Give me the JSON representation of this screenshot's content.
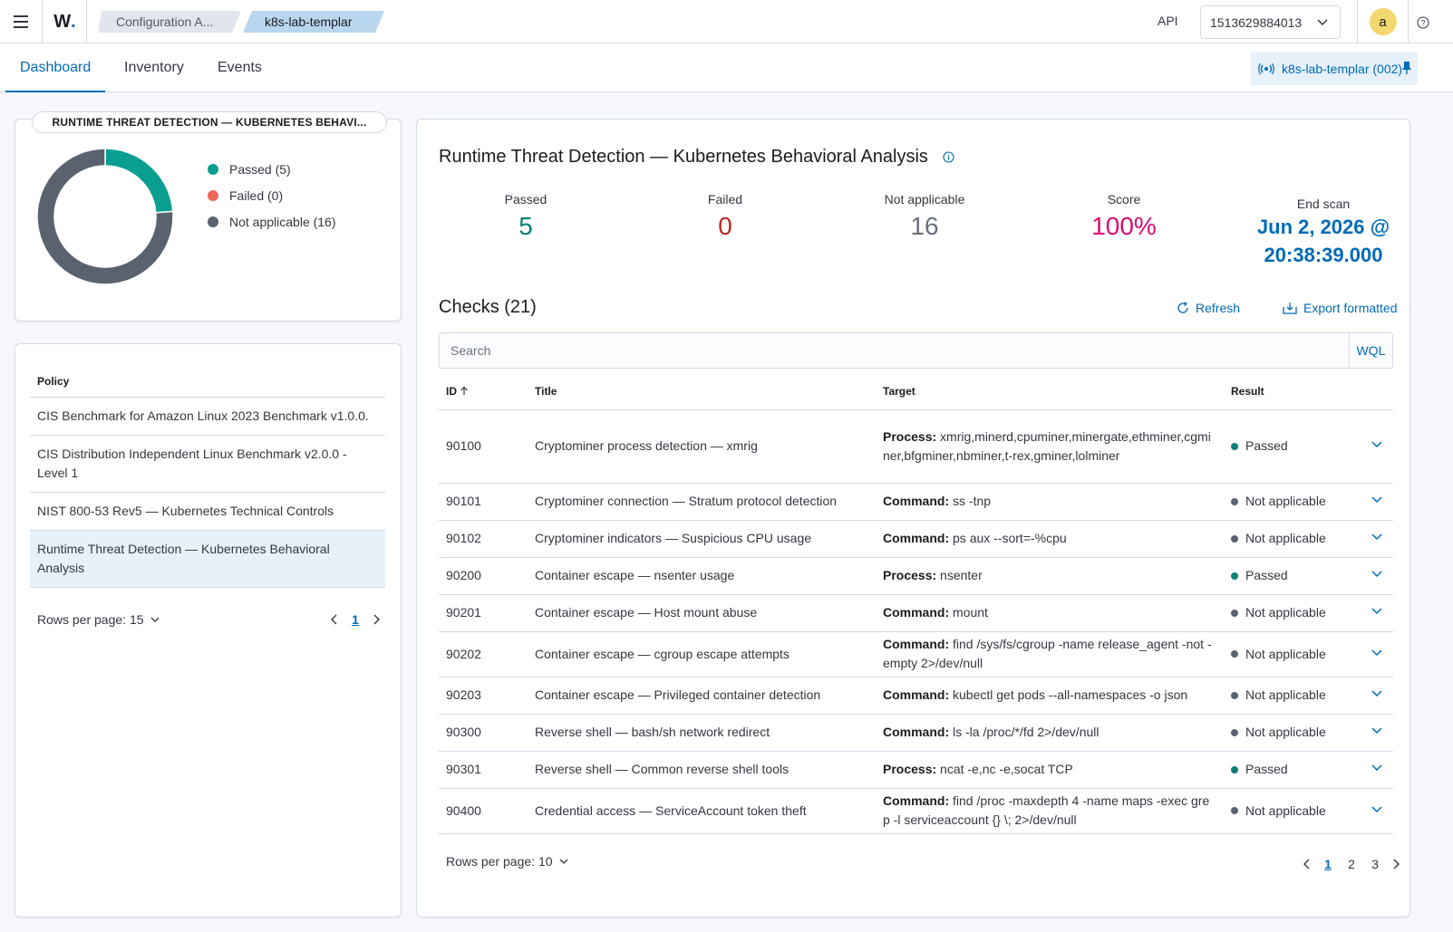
{
  "header": {
    "logo_text": "W",
    "logo_dot": ".",
    "breadcrumbs": [
      "Configuration A...",
      "k8s-lab-templar"
    ],
    "api_label": "API",
    "instance_id": "1513629884013",
    "avatar_letter": "a"
  },
  "tabs": [
    {
      "label": "Dashboard",
      "active": true
    },
    {
      "label": "Inventory",
      "active": false
    },
    {
      "label": "Events",
      "active": false
    }
  ],
  "agent_pill": {
    "label": "k8s-lab-templar (002)"
  },
  "donut": {
    "title": "RUNTIME THREAT DETECTION — KUBERNETES BEHAVI...",
    "legend": [
      "Passed (5)",
      "Failed (0)",
      "Not applicable (16)"
    ],
    "colors": {
      "passed": "#0a9e92",
      "failed": "#f0665e",
      "not_applicable": "#5a6270"
    }
  },
  "chart_data": {
    "type": "pie",
    "categories": [
      "Passed",
      "Failed",
      "Not applicable"
    ],
    "values": [
      5,
      0,
      16
    ]
  },
  "policies": {
    "header": "Policy",
    "items": [
      {
        "label": "CIS Benchmark for Amazon Linux 2023 Benchmark v1.0.0.",
        "selected": false
      },
      {
        "label": "CIS Distribution Independent Linux Benchmark v2.0.0 - Level 1",
        "selected": false
      },
      {
        "label": "NIST 800-53 Rev5 — Kubernetes Technical Controls",
        "selected": false
      },
      {
        "label": "Runtime Threat Detection — Kubernetes Behavioral Analysis",
        "selected": true
      }
    ],
    "rows_per_page": "Rows per page: 15",
    "current_page": "1"
  },
  "summary": {
    "title": "Runtime Threat Detection — Kubernetes Behavioral Analysis",
    "passed_label": "Passed",
    "passed_value": "5",
    "failed_label": "Failed",
    "failed_value": "0",
    "na_label": "Not applicable",
    "na_value": "16",
    "score_label": "Score",
    "score_value": "100%",
    "end_scan_label": "End scan",
    "end_scan_value_line1": "Jun 2, 2026 @",
    "end_scan_value_line2": "20:38:39.000"
  },
  "checks": {
    "title": "Checks (21)",
    "refresh_label": "Refresh",
    "export_label": "Export formatted",
    "search_placeholder": "Search",
    "wql_label": "WQL",
    "columns": {
      "id": "ID",
      "title": "Title",
      "target": "Target",
      "result": "Result"
    },
    "rows": [
      {
        "id": "90100",
        "title": "Cryptominer process detection — xmrig",
        "target_label": "Process:",
        "target_value": "xmrig,minerd,cpuminer,minergate,ethminer,cgminer,bfgminer,nbminer,t-rex,gminer,lolminer",
        "result": "Passed"
      },
      {
        "id": "90101",
        "title": "Cryptominer connection — Stratum protocol detection",
        "target_label": "Command:",
        "target_value": "ss -tnp",
        "result": "Not applicable"
      },
      {
        "id": "90102",
        "title": "Cryptominer indicators — Suspicious CPU usage",
        "target_label": "Command:",
        "target_value": "ps aux --sort=-%cpu",
        "result": "Not applicable"
      },
      {
        "id": "90200",
        "title": "Container escape — nsenter usage",
        "target_label": "Process:",
        "target_value": "nsenter",
        "result": "Passed"
      },
      {
        "id": "90201",
        "title": "Container escape — Host mount abuse",
        "target_label": "Command:",
        "target_value": "mount",
        "result": "Not applicable"
      },
      {
        "id": "90202",
        "title": "Container escape — cgroup escape attempts",
        "target_label": "Command:",
        "target_value": "find /sys/fs/cgroup -name release_agent -not -empty 2>/dev/null",
        "result": "Not applicable"
      },
      {
        "id": "90203",
        "title": "Container escape — Privileged container detection",
        "target_label": "Command:",
        "target_value": "kubectl get pods --all-namespaces -o json",
        "result": "Not applicable"
      },
      {
        "id": "90300",
        "title": "Reverse shell — bash/sh network redirect",
        "target_label": "Command:",
        "target_value": "ls -la /proc/*/fd 2>/dev/null",
        "result": "Not applicable"
      },
      {
        "id": "90301",
        "title": "Reverse shell — Common reverse shell tools",
        "target_label": "Process:",
        "target_value": "ncat -e,nc -e,socat TCP",
        "result": "Passed"
      },
      {
        "id": "90400",
        "title": "Credential access — ServiceAccount token theft",
        "target_label": "Command:",
        "target_value": "find /proc -maxdepth 4 -name maps -exec grep -l serviceaccount {} \\; 2>/dev/null",
        "result": "Not applicable"
      }
    ],
    "rows_per_page": "Rows per page: 10",
    "pages": [
      "1",
      "2",
      "3"
    ]
  },
  "colors": {
    "accent": "#006bb8",
    "passed": "#0a7f75",
    "failed": "#bd271e",
    "score": "#dd0a73",
    "na_text": "#69707d",
    "na_dot": "#5a6270",
    "passed_dot": "#0a7f75"
  }
}
